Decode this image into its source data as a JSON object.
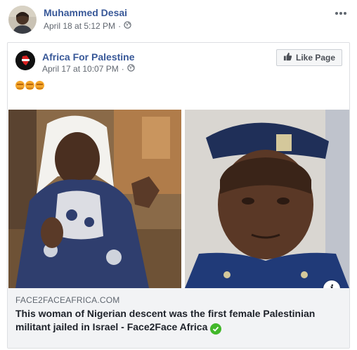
{
  "post": {
    "author": "Muhammed Desai",
    "timestamp": "April 18 at 5:12 PM",
    "privacy_separator": "·",
    "more_icon": "more-horizontal-icon"
  },
  "shared_post": {
    "page_name": "Africa For Palestine",
    "timestamp": "April 17 at 10:07 PM",
    "privacy_separator": "·",
    "like_page_label": "Like Page",
    "emoji_text_icon": "raised-fist-emoji-icon"
  },
  "link_preview": {
    "domain": "FACE2FACEAFRICA.COM",
    "title": "This woman of Nigerian descent was the first female Palestinian militant jailed in Israel - Face2Face Africa",
    "info_icon": "info-icon"
  },
  "colors": {
    "link_blue": "#385898",
    "meta_gray": "#616770",
    "caption_bg": "#f2f3f5",
    "verified_green": "#42b72a"
  }
}
